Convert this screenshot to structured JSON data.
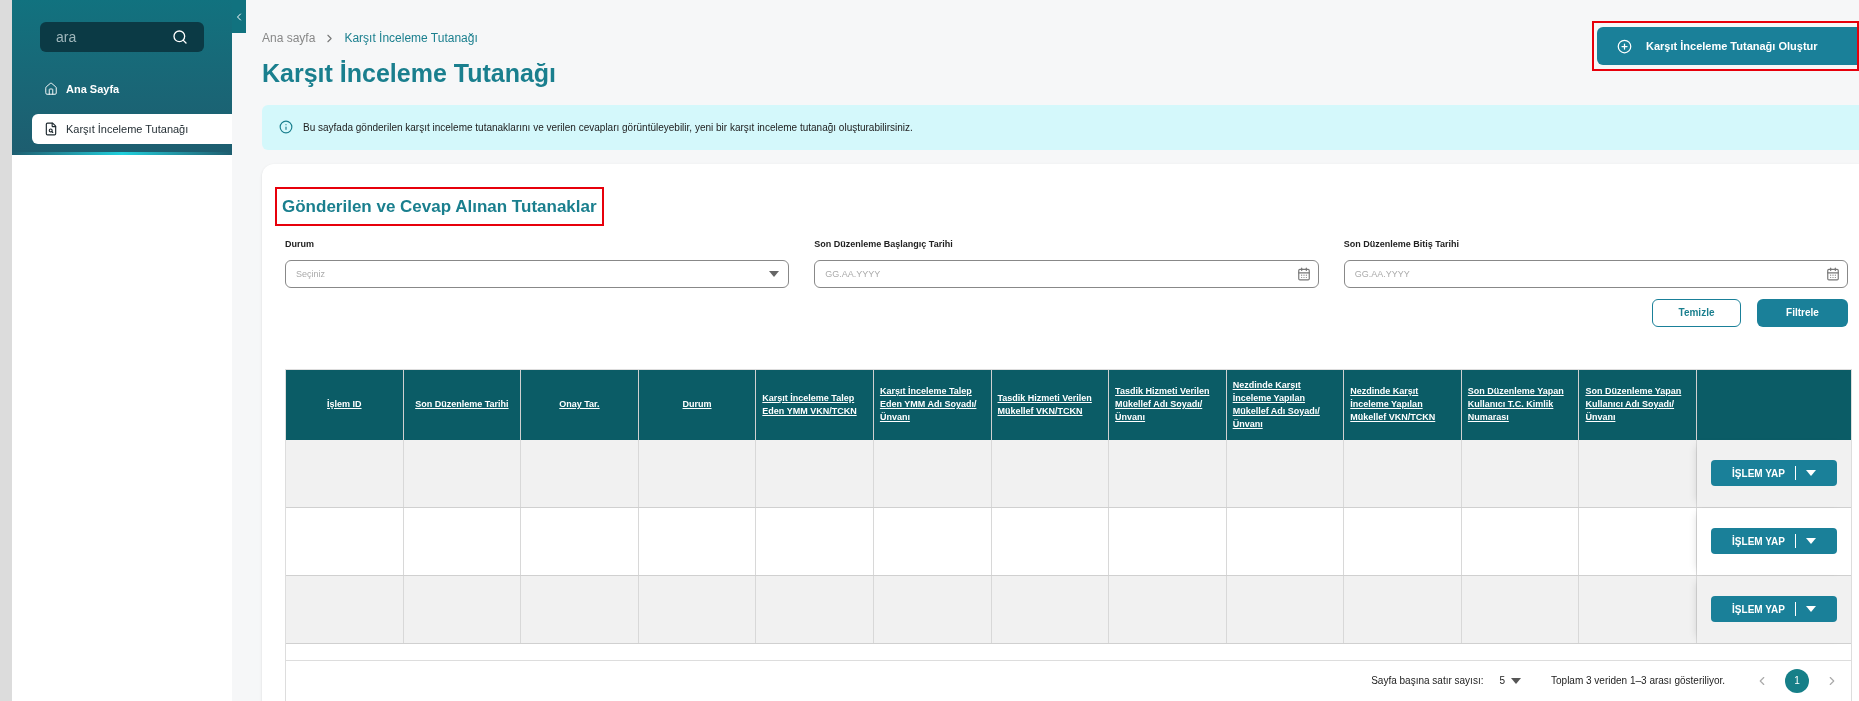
{
  "sidebar": {
    "search": {
      "placeholder": "ara"
    },
    "items": [
      {
        "label": "Ana Sayfa",
        "kind": "home",
        "selected": false
      },
      {
        "label": "Karşıt İnceleme Tutanağı",
        "kind": "document",
        "selected": true
      }
    ]
  },
  "breadcrumb": [
    {
      "label": "Ana sayfa",
      "selected": false
    },
    {
      "label": "Karşıt İnceleme Tutanağı",
      "selected": true
    }
  ],
  "page_title": "Karşıt İnceleme Tutanağı",
  "create_button": {
    "label": "Karşıt İnceleme Tutanağı Oluştur",
    "highlighted": true
  },
  "info_message": "Bu sayfada gönderilen karşıt inceleme tutanaklarını ve verilen cevapları görüntüleyebilir, yeni bir karşıt inceleme tutanağı oluşturabilirsiniz.",
  "section": {
    "title": "Gönderilen ve Cevap Alınan Tutanaklar",
    "highlighted": true
  },
  "filters": [
    {
      "kind": "select",
      "label": "Durum",
      "placeholder": "Seçiniz"
    },
    {
      "kind": "date",
      "label": "Son Düzenleme Başlangıç Tarihi",
      "placeholder": "GG.AA.YYYY"
    },
    {
      "kind": "date",
      "label": "Son Düzenleme Bitiş Tarihi",
      "placeholder": "GG.AA.YYYY"
    }
  ],
  "filter_buttons": [
    {
      "kind": "outline",
      "label": "Temizle"
    },
    {
      "kind": "solid",
      "label": "Filtrele"
    }
  ],
  "table": {
    "columns": [
      "İşlem ID",
      "Son Düzenleme Tarihi",
      "Onay Tar.",
      "Durum",
      "Karşıt İnceleme Talep Eden YMM VKN/TCKN",
      "Karşıt İnceleme Talep Eden YMM Adı Soyadı/Ünvanı",
      "Tasdik Hizmeti Verilen Mükellef VKN/TCKN",
      "Tasdik Hizmeti Verilen Mükellef Adı Soyadı/Ünvanı",
      "Nezdinde Karşıt İnceleme Yapılan Mükellef Adı Soyadı/ Ünvanı",
      "Nezdinde Karşıt İnceleme Yapılan Mükellef VKN/TCKN",
      "Son Düzenleme Yapan Kullanıcı T.C. Kimlik Numarası",
      "Son Düzenleme Yapan Kullanıcı Adı Soyadı/Ünvanı"
    ],
    "rows": [
      {
        "action": "İŞLEM YAP"
      },
      {
        "action": "İŞLEM YAP"
      },
      {
        "action": "İŞLEM YAP"
      }
    ]
  },
  "pagination": {
    "rows_per_page_label": "Sayfa başına satır sayısı:",
    "rows_per_page": "5",
    "summary": "Toplam 3 veriden 1–3 arası gösteriliyor.",
    "pages": [
      {
        "label": "1",
        "selected": true
      }
    ]
  }
}
